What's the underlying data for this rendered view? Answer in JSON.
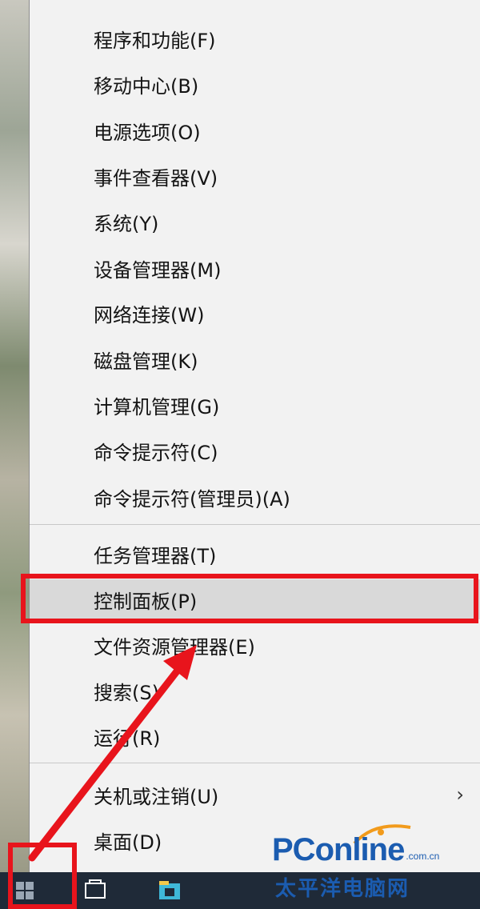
{
  "menu": {
    "items": [
      {
        "label": "程序和功能(F)"
      },
      {
        "label": "移动中心(B)"
      },
      {
        "label": "电源选项(O)"
      },
      {
        "label": "事件查看器(V)"
      },
      {
        "label": "系统(Y)"
      },
      {
        "label": "设备管理器(M)"
      },
      {
        "label": "网络连接(W)"
      },
      {
        "label": "磁盘管理(K)"
      },
      {
        "label": "计算机管理(G)"
      },
      {
        "label": "命令提示符(C)"
      },
      {
        "label": "命令提示符(管理员)(A)"
      },
      {
        "label": "任务管理器(T)"
      },
      {
        "label": "控制面板(P)",
        "highlighted": true
      },
      {
        "label": "文件资源管理器(E)"
      },
      {
        "label": "搜索(S)"
      },
      {
        "label": "运行(R)"
      },
      {
        "label": "关机或注销(U)",
        "submenu": true
      },
      {
        "label": "桌面(D)"
      }
    ],
    "submenu_arrow": "›"
  },
  "annotations": {
    "highlight_color": "#e8141c"
  },
  "taskbar": {
    "icons": [
      "start-icon",
      "task-view-icon",
      "file-explorer-icon"
    ]
  },
  "watermark": {
    "brand": "PConline",
    "domain": ".com.cn",
    "chinese": "太平洋电脑网"
  }
}
